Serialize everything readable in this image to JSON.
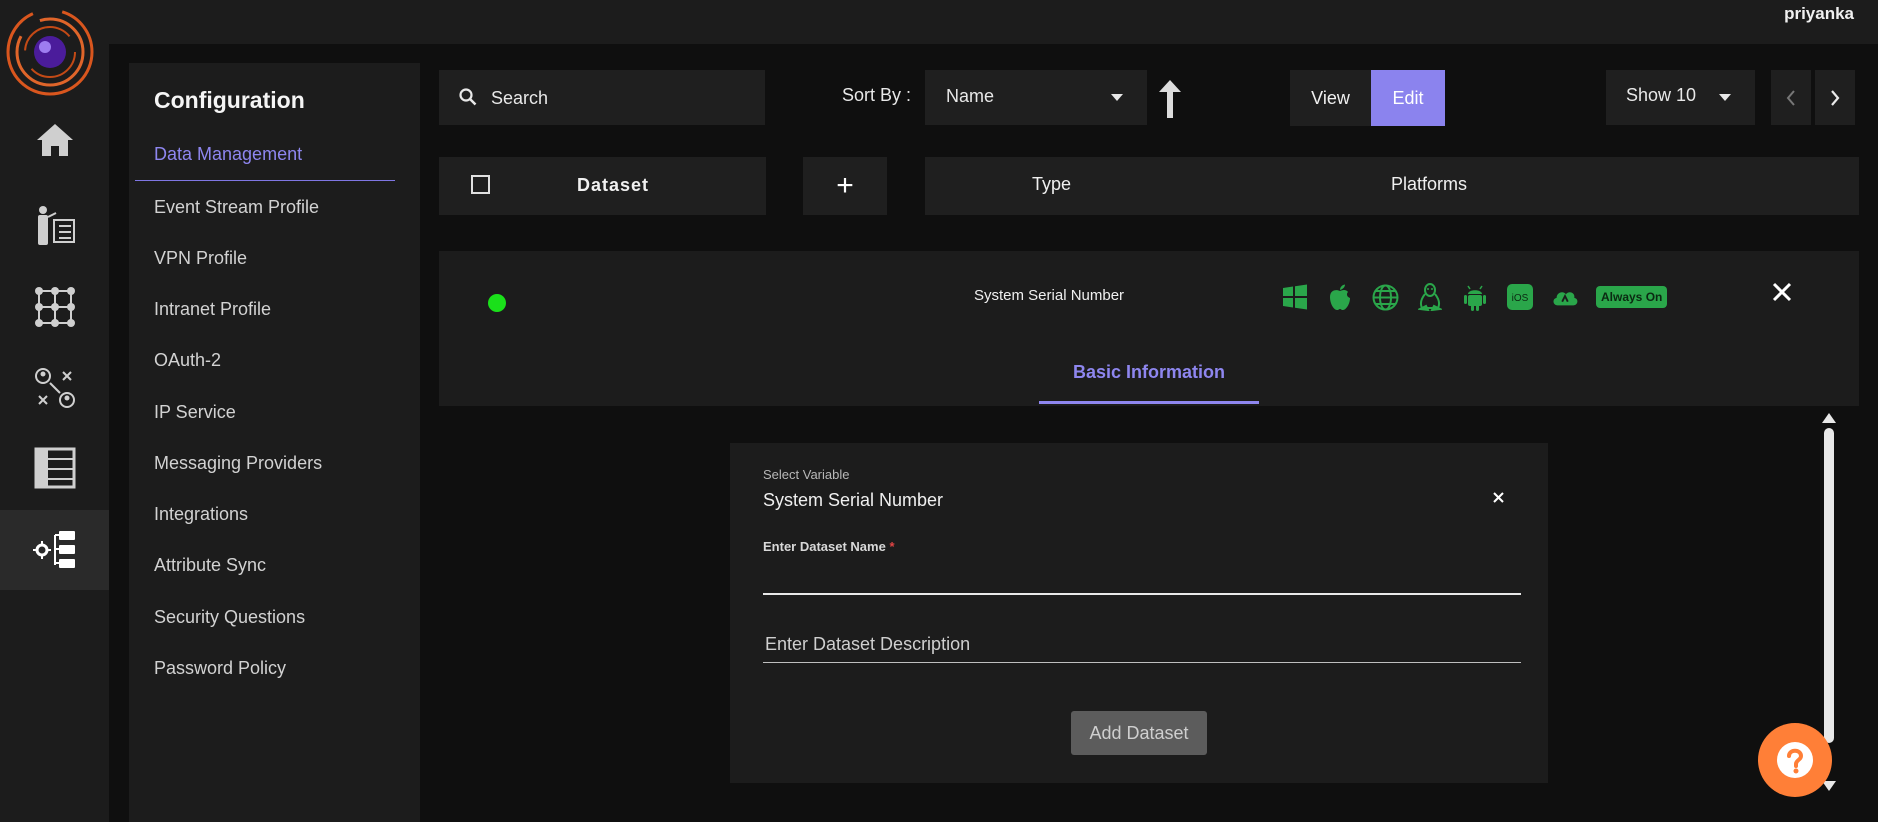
{
  "header": {
    "username": "priyanka"
  },
  "sidebar": {
    "items": [
      {
        "icon": "home-icon"
      },
      {
        "icon": "user-list-icon"
      },
      {
        "icon": "grid-dots-icon"
      },
      {
        "icon": "user-network-icon"
      },
      {
        "icon": "table-icon"
      },
      {
        "icon": "settings-tree-icon",
        "active": true
      }
    ]
  },
  "config": {
    "title": "Configuration",
    "active_item": "Data Management",
    "items": [
      "Event Stream Profile",
      "VPN Profile",
      "Intranet Profile",
      "OAuth-2",
      "IP Service",
      "Messaging Providers",
      "Integrations",
      "Attribute Sync",
      "Security Questions",
      "Password Policy"
    ]
  },
  "toolbar": {
    "search_placeholder": "Search",
    "sort_label": "Sort By :",
    "sort_value": "Name",
    "view_label": "View",
    "edit_label": "Edit",
    "show_value": "Show 10"
  },
  "table_header": {
    "dataset": "Dataset",
    "add": "+",
    "type": "Type",
    "platforms": "Platforms"
  },
  "row": {
    "name": "System Serial Number",
    "status_color": "#1ae01a",
    "platforms": [
      "windows-icon",
      "apple-icon",
      "web-icon",
      "linux-icon",
      "android-icon",
      "ios-icon",
      "cloud-icon"
    ],
    "ios_label": "iOS",
    "always_on": "Always On"
  },
  "tabs": {
    "basic": "Basic Information"
  },
  "form": {
    "select_variable_label": "Select Variable",
    "select_variable_value": "System Serial Number",
    "dataset_name_label": "Enter Dataset Name",
    "required_marker": "*",
    "dataset_desc_placeholder": "Enter Dataset Description",
    "add_button": "Add Dataset"
  },
  "colors": {
    "accent": "#8b83ee",
    "platform_green": "#2aa64a",
    "help": "#ff7f37"
  }
}
